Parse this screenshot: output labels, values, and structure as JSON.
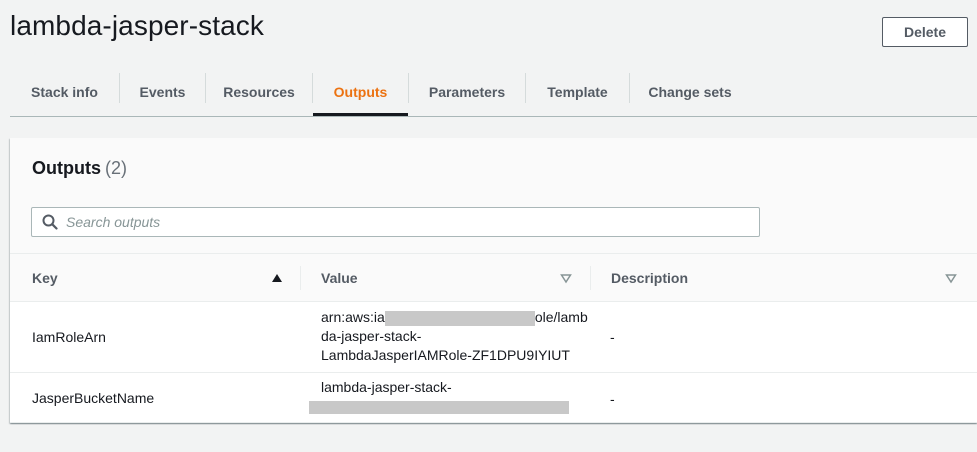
{
  "page": {
    "title": "lambda-jasper-stack",
    "delete_label": "Delete"
  },
  "tabs": [
    {
      "label": "Stack info"
    },
    {
      "label": "Events"
    },
    {
      "label": "Resources"
    },
    {
      "label": "Outputs",
      "active": true
    },
    {
      "label": "Parameters"
    },
    {
      "label": "Template"
    },
    {
      "label": "Change sets"
    }
  ],
  "outputs": {
    "title": "Outputs",
    "count": "(2)",
    "search_placeholder": "Search outputs",
    "columns": {
      "key": "Key",
      "value": "Value",
      "description": "Description"
    },
    "rows": [
      {
        "key": "IamRoleArn",
        "value_line1_start": "arn:aws:ia",
        "value_line1_end": "ole/lamb",
        "value_line2": "da-jasper-stack-",
        "value_line3": "LambdaJasperIAMRole-ZF1DPU9IYIUT",
        "description": "-"
      },
      {
        "key": "JasperBucketName",
        "value_line1": "lambda-jasper-stack-",
        "description": "-"
      }
    ]
  },
  "colors": {
    "accent": "#ec7211",
    "text": "#16191f",
    "muted": "#545b64"
  },
  "icons": {
    "search": "search-icon",
    "sort_asc": "sort-ascending-icon",
    "sort_none": "sort-icon"
  }
}
